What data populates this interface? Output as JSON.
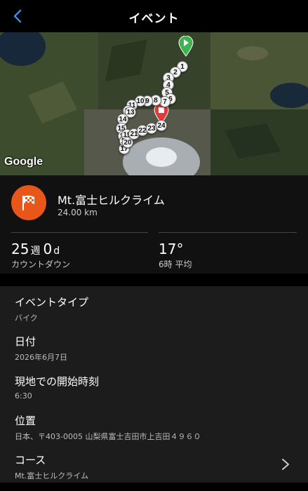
{
  "header": {
    "title": "イベント"
  },
  "map": {
    "attribution": "Google",
    "markers": [
      "1",
      "2",
      "3",
      "4",
      "5",
      "6",
      "7",
      "8",
      "9",
      "10",
      "11",
      "12",
      "13",
      "14",
      "15",
      "16",
      "17",
      "18",
      "19",
      "20",
      "21",
      "22",
      "23",
      "24"
    ]
  },
  "event": {
    "name": "Mt.富士ヒルクライム",
    "distance": "24.00 km",
    "icon": "checkered-flag-icon",
    "accent_color": "#e8561a"
  },
  "countdown": {
    "weeks": "25",
    "weeks_unit": "週",
    "days": "0",
    "days_unit": "d",
    "label": "カウントダウン"
  },
  "weather": {
    "temperature": "17°",
    "label": "6時 平均"
  },
  "details": {
    "event_type": {
      "label": "イベントタイプ",
      "value": "バイク"
    },
    "date": {
      "label": "日付",
      "value": "2026年6月7日"
    },
    "start_time": {
      "label": "現地での開始時刻",
      "value": "6:30"
    },
    "location": {
      "label": "位置",
      "value": "日本、〒403-0005 山梨県富士吉田市上吉田４９６０"
    },
    "course": {
      "label": "コース",
      "value": "Mt.富士ヒルクライム"
    }
  }
}
